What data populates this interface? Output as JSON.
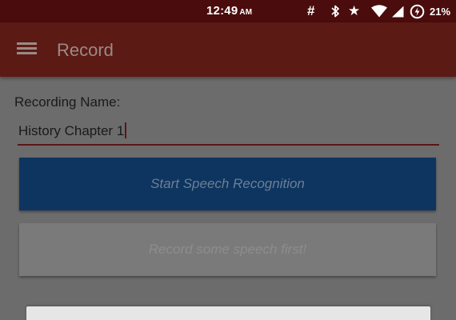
{
  "status_bar": {
    "time": "12:49",
    "ampm": "AM",
    "icons": [
      "hash-icon",
      "bluetooth-icon",
      "star-icon",
      "wifi-icon",
      "signal-icon",
      "battery-saver-icon"
    ],
    "battery_percent": "21%"
  },
  "app_bar": {
    "menu_icon": "hamburger-menu-icon",
    "title": "Record"
  },
  "form": {
    "name_label": "Recording Name:",
    "name_value": "History Chapter 1"
  },
  "buttons": {
    "start_label": "Start Speech Recognition",
    "record_first_label": "Record some speech first!"
  },
  "colors": {
    "status_bar": "#4a0c0c",
    "app_bar": "#5c1a14",
    "primary_button": "#0d3560",
    "disabled_button": "#7a7a7a",
    "input_underline": "#5a1616"
  }
}
